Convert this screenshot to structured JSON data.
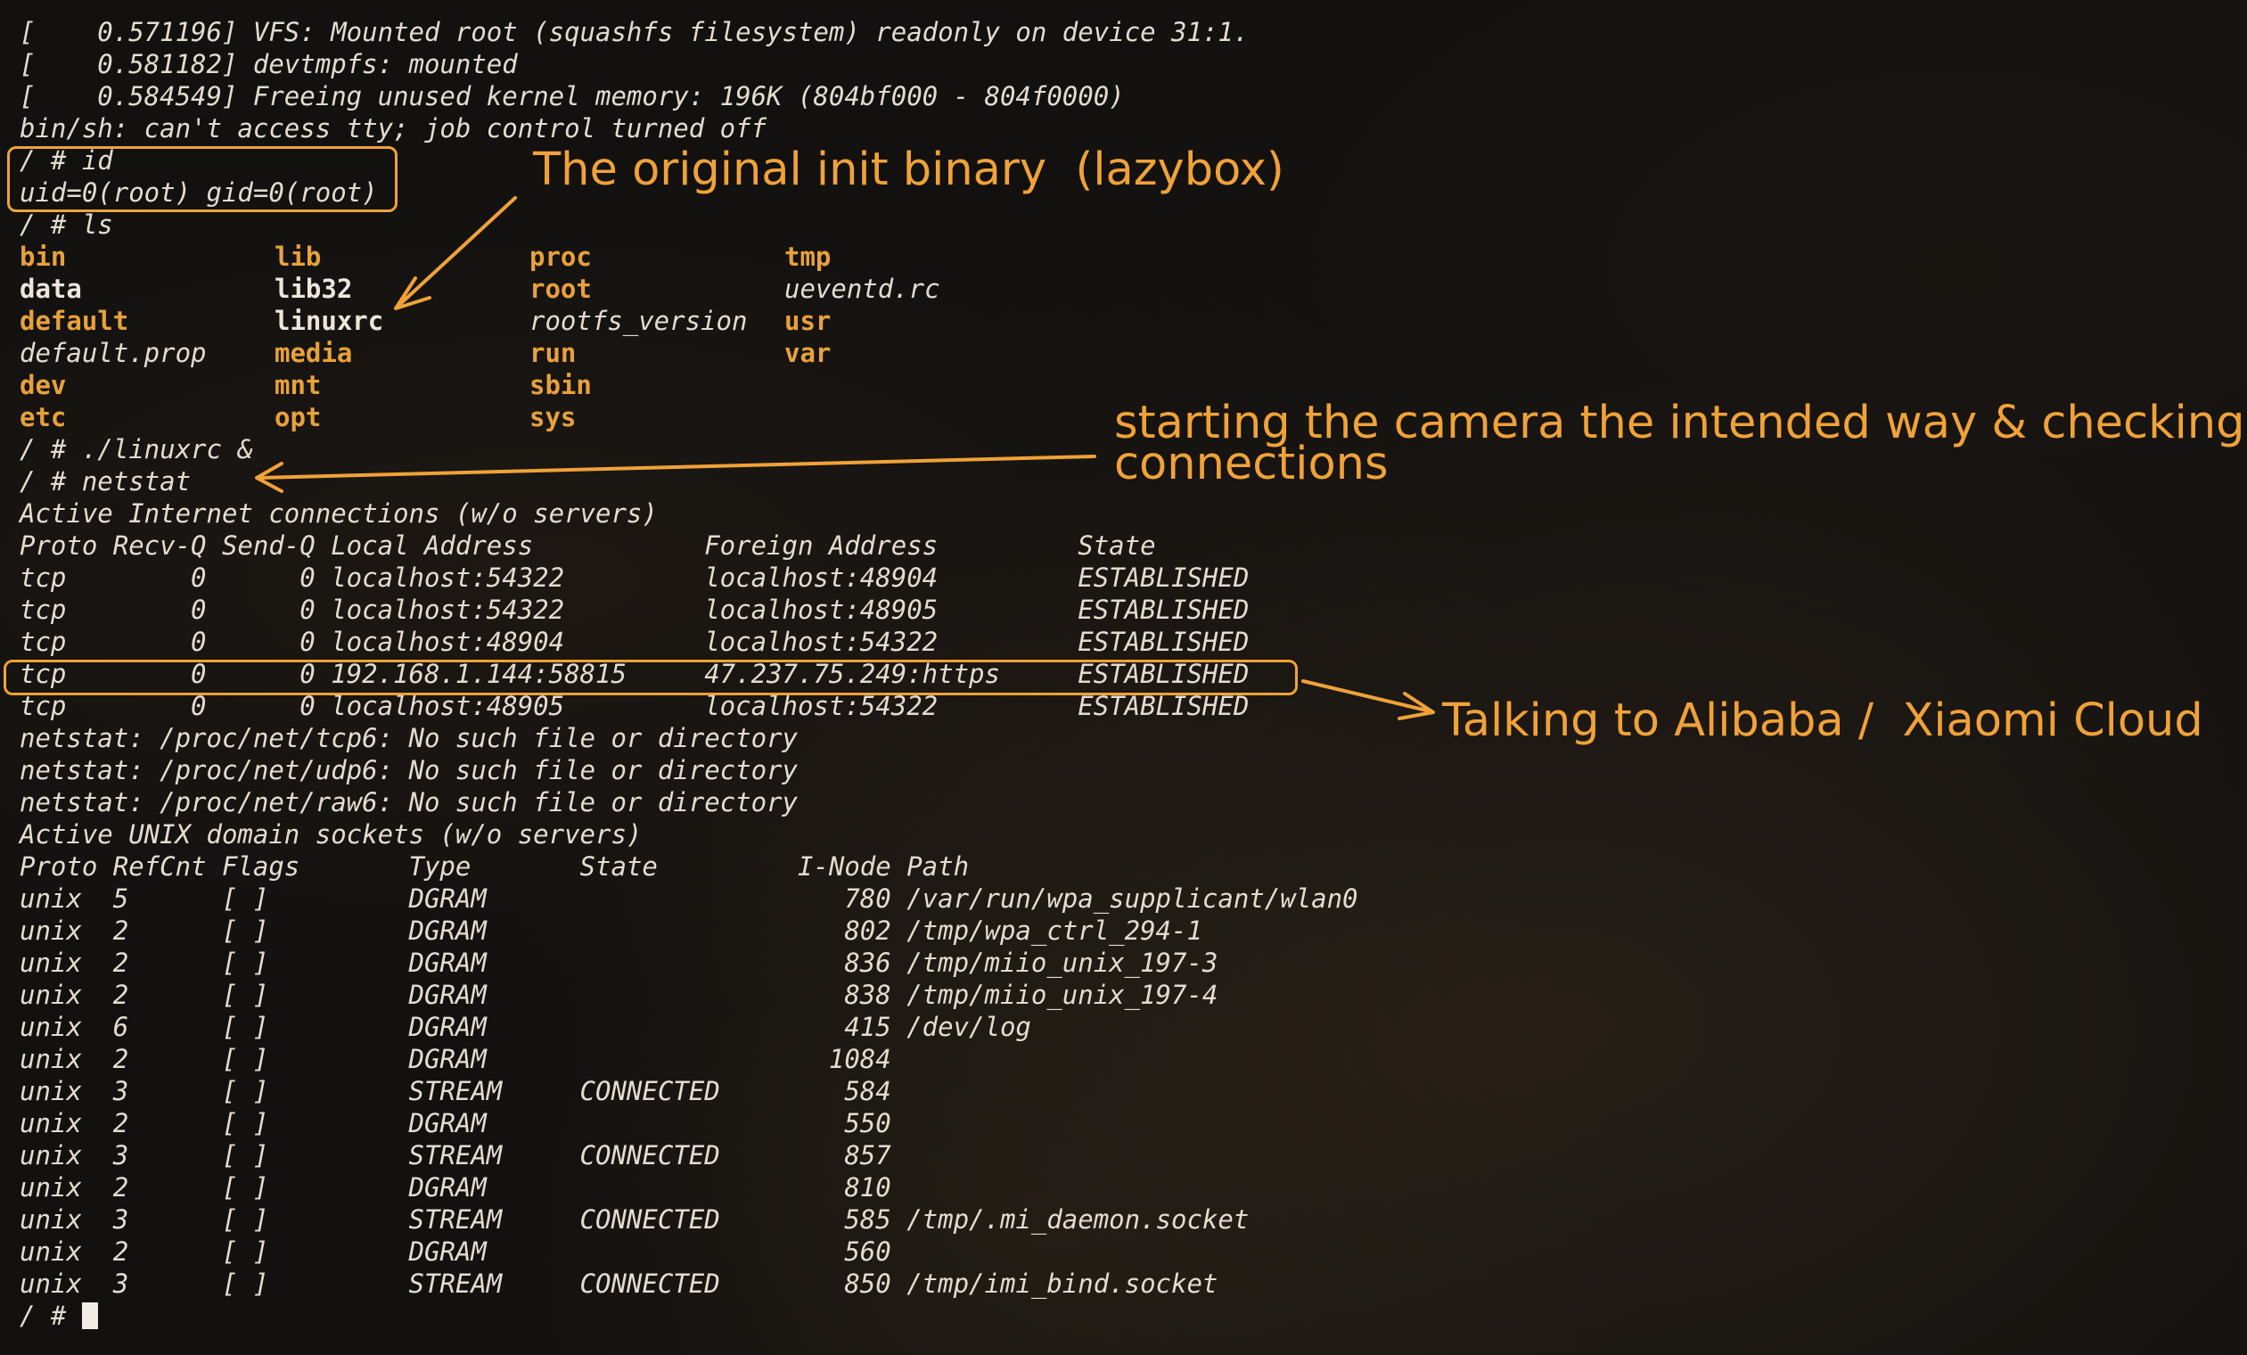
{
  "boot": [
    "[    0.571196] VFS: Mounted root (squashfs filesystem) readonly on device 31:1.",
    "[    0.581182] devtmpfs: mounted",
    "[    0.584549] Freeing unused kernel memory: 196K (804bf000 - 804f0000)",
    "bin/sh: can't access tty; job control turned off"
  ],
  "id_cmd": "/ # id",
  "id_out": "uid=0(root) gid=0(root)",
  "ls_cmd": "/ # ls",
  "ls_rows": [
    [
      {
        "t": "bin",
        "d": true
      },
      {
        "t": "lib",
        "d": true
      },
      {
        "t": "proc",
        "d": true
      },
      {
        "t": "tmp",
        "d": true
      }
    ],
    [
      {
        "t": "data",
        "b": true
      },
      {
        "t": "lib32",
        "b": true
      },
      {
        "t": "root",
        "d": true
      },
      {
        "t": "ueventd.rc"
      }
    ],
    [
      {
        "t": "default",
        "d": true
      },
      {
        "t": "linuxrc",
        "b": true
      },
      {
        "t": "rootfs_version"
      },
      {
        "t": "usr",
        "d": true
      }
    ],
    [
      {
        "t": "default.prop"
      },
      {
        "t": "media",
        "d": true
      },
      {
        "t": "run",
        "d": true
      },
      {
        "t": "var",
        "d": true
      }
    ],
    [
      {
        "t": "dev",
        "d": true
      },
      {
        "t": "mnt",
        "d": true
      },
      {
        "t": "sbin",
        "d": true
      },
      {
        "t": ""
      }
    ],
    [
      {
        "t": "etc",
        "d": true
      },
      {
        "t": "opt",
        "d": true
      },
      {
        "t": "sys",
        "d": true
      },
      {
        "t": ""
      }
    ]
  ],
  "linuxrc_cmd": "/ # ./linuxrc &",
  "netstat_cmd": "/ # netstat",
  "inet_title": "Active Internet connections (w/o servers)",
  "inet_header": "Proto Recv-Q Send-Q Local Address           Foreign Address         State",
  "inet_rows": [
    "tcp        0      0 localhost:54322         localhost:48904         ESTABLISHED",
    "tcp        0      0 localhost:54322         localhost:48905         ESTABLISHED",
    "tcp        0      0 localhost:48904         localhost:54322         ESTABLISHED",
    "tcp        0      0 192.168.1.144:58815     47.237.75.249:https     ESTABLISHED",
    "tcp        0      0 localhost:48905         localhost:54322         ESTABLISHED"
  ],
  "errors": [
    "netstat: /proc/net/tcp6: No such file or directory",
    "netstat: /proc/net/udp6: No such file or directory",
    "netstat: /proc/net/raw6: No such file or directory"
  ],
  "unix_title": "Active UNIX domain sockets (w/o servers)",
  "unix_header": "Proto RefCnt Flags       Type       State         I-Node Path",
  "unix_rows": [
    "unix  5      [ ]         DGRAM                       780 /var/run/wpa_supplicant/wlan0",
    "unix  2      [ ]         DGRAM                       802 /tmp/wpa_ctrl_294-1",
    "unix  2      [ ]         DGRAM                       836 /tmp/miio_unix_197-3",
    "unix  2      [ ]         DGRAM                       838 /tmp/miio_unix_197-4",
    "unix  6      [ ]         DGRAM                       415 /dev/log",
    "unix  2      [ ]         DGRAM                      1084",
    "unix  3      [ ]         STREAM     CONNECTED        584",
    "unix  2      [ ]         DGRAM                       550",
    "unix  3      [ ]         STREAM     CONNECTED        857",
    "unix  2      [ ]         DGRAM                       810",
    "unix  3      [ ]         STREAM     CONNECTED        585 /tmp/.mi_daemon.socket",
    "unix  2      [ ]         DGRAM                       560",
    "unix  3      [ ]         STREAM     CONNECTED        850 /tmp/imi_bind.socket"
  ],
  "prompt": "/ # ",
  "annotations": {
    "init": "The original init binary  (lazybox)",
    "camera": "starting the camera the intended way & checking\nconnections",
    "cloud": "Talking to Alibaba /  Xiaomi Cloud"
  },
  "accent_color": "#f0a238",
  "dir_color": "#e8a13a"
}
